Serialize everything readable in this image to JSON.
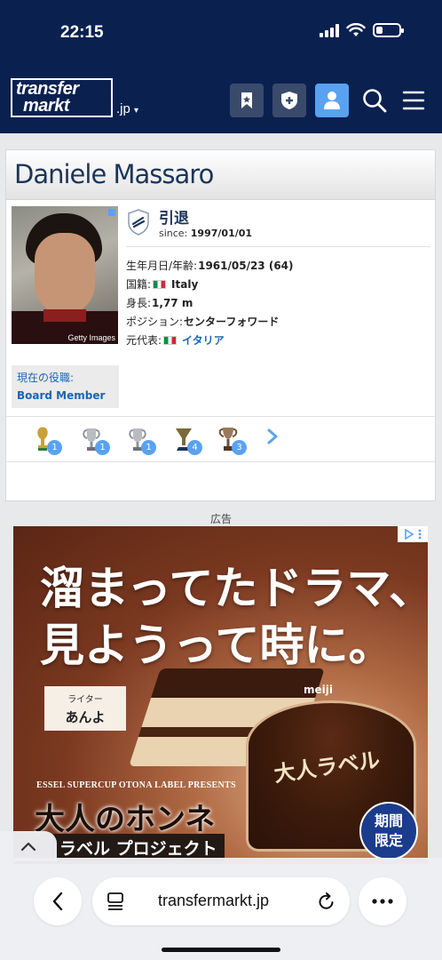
{
  "status": {
    "time": "22:15"
  },
  "header": {
    "logo_line1": "transfer",
    "logo_line2": "markt",
    "domain": ".jp",
    "domain_caret": "▾"
  },
  "player": {
    "first_name": "Daniele",
    "last_name": "Massaro",
    "photo_credit": "Getty Images",
    "status_label": "引退",
    "since_label": "since:",
    "since_date": "1997/01/01",
    "facts": [
      {
        "label": "生年月日/年齢:",
        "value": "1961/05/23 (64)"
      },
      {
        "label": "国籍:",
        "value": "Italy"
      },
      {
        "label": "身長:",
        "value": "1,77 m"
      },
      {
        "label": "ポジション:",
        "value": "センターフォワード"
      },
      {
        "label": "元代表:",
        "value": "イタリア"
      }
    ],
    "role_title": "現在の役職:",
    "role_value": "Board Member"
  },
  "trophies": [
    {
      "icon": "world-cup-trophy-icon",
      "count": "1"
    },
    {
      "icon": "champions-league-trophy-icon",
      "count": "1"
    },
    {
      "icon": "champions-league-trophy-icon",
      "count": "1"
    },
    {
      "icon": "league-title-trophy-icon",
      "count": "4"
    },
    {
      "icon": "cup-trophy-icon",
      "count": "3"
    }
  ],
  "ad": {
    "label": "広告",
    "headline1": "溜まってたドラマ、",
    "headline2": "見ようって時に。",
    "writer_label": "ライター",
    "writer_name": "あんよ",
    "brand": "meiji",
    "cup_text": "大人ラベル",
    "presents": "ESSEL SUPERCUP OTONA LABEL PRESENTS",
    "big_text": "大人のホンネ",
    "label_project": "ラベル プロジェクト",
    "limited_line1": "期間",
    "limited_line2": "限定"
  },
  "browser": {
    "url": "transfermarkt.jp"
  },
  "colors": {
    "header_bg": "#0a2150",
    "accent": "#5aa2f0",
    "link": "#1a65b3"
  }
}
